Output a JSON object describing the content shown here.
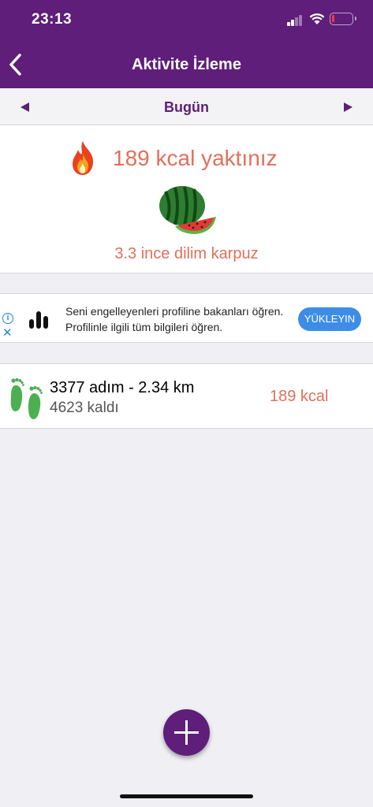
{
  "status_bar": {
    "time": "23:13"
  },
  "nav": {
    "title": "Aktivite İzleme"
  },
  "date_bar": {
    "label": "Bugün"
  },
  "summary": {
    "burned_text": "189 kcal yaktınız",
    "equivalent_text": "3.3 ince dilim karpuz"
  },
  "ad": {
    "text": "Seni engelleyenleri profiline bakanları öğren. Profilinle ilgili tüm bilgileri öğren.",
    "info_glyph": "i",
    "close_glyph": "✕",
    "button_label": "YÜKLEYIN"
  },
  "activity": {
    "steps_text": "3377 adım - 2.34 km",
    "remaining_text": "4623 kaldı",
    "kcal_text": "189 kcal"
  },
  "colors": {
    "brand_purple": "#5e1e7a",
    "calorie_red": "#e2705a",
    "ad_button_blue": "#3d8de8",
    "foot_green": "#4caf50"
  }
}
